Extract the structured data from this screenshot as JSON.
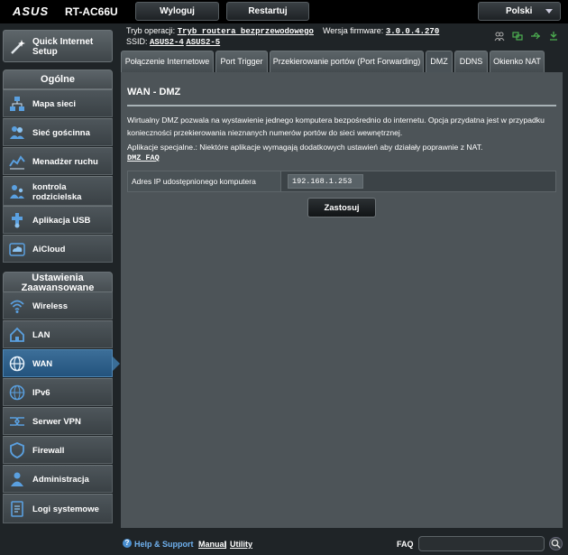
{
  "header": {
    "brand": "ASUS",
    "model": "RT-AC66U",
    "logout_label": "Wyloguj",
    "restart_label": "Restartuj",
    "language": "Polski",
    "mode_label": "Tryb operacji:",
    "mode_value": "Tryb routera bezprzewodowego",
    "firmware_label": "Wersja firmware:",
    "firmware_value": "3.0.0.4.270",
    "ssid_label": "SSID:",
    "ssid_1": "ASUS2-4",
    "ssid_2": "ASUS2-5"
  },
  "sidebar": {
    "quick_setup": "Quick Internet Setup",
    "general_header": "Ogólne",
    "general_items": [
      {
        "label": "Mapa sieci",
        "icon": "network-map-icon"
      },
      {
        "label": "Sieć gościnna",
        "icon": "guest-network-icon"
      },
      {
        "label": "Menadżer ruchu",
        "icon": "traffic-manager-icon"
      },
      {
        "label": "kontrola rodzicielska",
        "icon": "parental-control-icon"
      },
      {
        "label": "Aplikacja USB",
        "icon": "usb-application-icon"
      },
      {
        "label": "AiCloud",
        "icon": "aicloud-icon"
      }
    ],
    "advanced_header": "Ustawienia Zaawansowane",
    "advanced_items": [
      {
        "label": "Wireless",
        "icon": "wireless-icon"
      },
      {
        "label": "LAN",
        "icon": "lan-icon"
      },
      {
        "label": "WAN",
        "icon": "wan-icon",
        "active": true
      },
      {
        "label": "IPv6",
        "icon": "ipv6-icon"
      },
      {
        "label": "Serwer VPN",
        "icon": "vpn-server-icon"
      },
      {
        "label": "Firewall",
        "icon": "firewall-icon"
      },
      {
        "label": "Administracja",
        "icon": "administration-icon"
      },
      {
        "label": "Logi systemowe",
        "icon": "system-log-icon"
      }
    ]
  },
  "tabs": [
    {
      "label": "Połączenie Internetowe"
    },
    {
      "label": "Port Trigger"
    },
    {
      "label": "Przekierowanie portów (Port Forwarding)"
    },
    {
      "label": "DMZ",
      "active": true
    },
    {
      "label": "DDNS"
    },
    {
      "label": "Okienko NAT"
    }
  ],
  "main": {
    "title": "WAN - DMZ",
    "description_1": "Wirtualny DMZ pozwala na wystawienie jednego komputera bezpośrednio do internetu. Opcja przydatna jest w przypadku konieczności przekierowania nieznanych numerów portów do sieci wewnętrznej.",
    "description_2": "Aplikacje specjalne.: Niektóre aplikacje wymagają dodatkowych ustawień aby działały poprawnie z NAT.",
    "faq_link": "DMZ FAQ",
    "field_label": "Adres IP udostępnionego komputera",
    "field_value": "192.168.1.253",
    "apply_label": "Zastosuj"
  },
  "footer": {
    "help": "Help & Support",
    "manual": "Manual",
    "separator": "|",
    "utility": "Utility",
    "faq": "FAQ"
  }
}
